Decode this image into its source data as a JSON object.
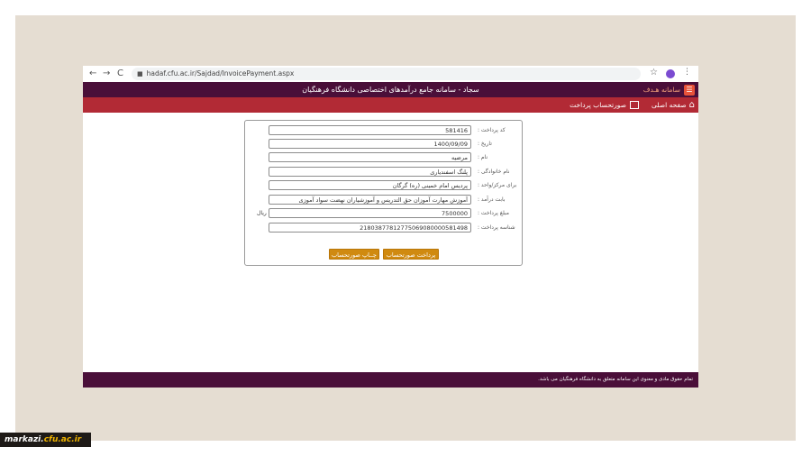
{
  "browser": {
    "back": "←",
    "forward": "→",
    "reload": "C",
    "url": "hadaf.cfu.ac.ir/Sajdad/InvoicePayment.aspx",
    "star": "☆",
    "menu": "⋮"
  },
  "header": {
    "title": "سجاد - سامانه جامع درآمدهای اختصاصی دانشگاه فرهنگیان",
    "brand": "سامانه هـدف"
  },
  "nav": {
    "home": "صفحه اصلی",
    "invoice": "صورتحساب پرداخت"
  },
  "form": {
    "fields": [
      {
        "label": "کد پرداخت :",
        "value": "581416"
      },
      {
        "label": "تاریخ :",
        "value": "1400/09/09"
      },
      {
        "label": "نام :",
        "value": "مرضیه"
      },
      {
        "label": "نام خانوادگی :",
        "value": "پلنگ اسفندیاری"
      },
      {
        "label": "برای مرکز/واحد :",
        "value": "پردیس امام خمینی (ره) گرگان"
      },
      {
        "label": "بابت درآمد :",
        "value": "آموزش مهارت آموزان حق التدریس و آموزشیاران نهضت سواد آموزی"
      },
      {
        "label": "مبلغ پرداخت :",
        "value": "7500000",
        "unit": "ریال"
      },
      {
        "label": "شناسه پرداخت :",
        "value": "21803877812775069080000581498"
      }
    ],
    "pay_button": "پرداخت صورتحساب",
    "print_button": "چــاپ صورتحساب"
  },
  "footer": {
    "text": "تمام حقوق مادی و معنوی این سامانه متعلق به دانشگاه فرهنگیان می باشد."
  },
  "watermark": {
    "part1": "markazi.",
    "part2": "cfu.ac.ir"
  }
}
